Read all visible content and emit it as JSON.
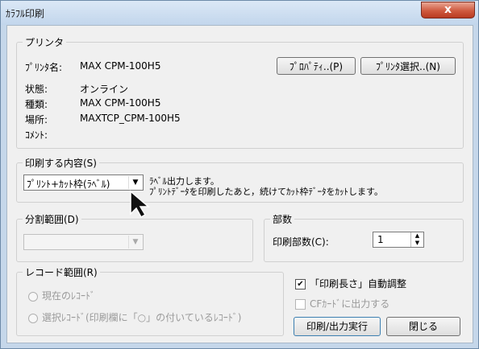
{
  "window": {
    "title": "ｶﾗﾌﾙ印刷",
    "close_label": "x"
  },
  "printer_group": {
    "legend": "プリンタ",
    "name_label": "ﾌﾟﾘﾝﾀ名:",
    "name_value": "MAX CPM-100H5",
    "status_label": "状態:",
    "status_value": "オンライン",
    "type_label": "種類:",
    "type_value": "MAX CPM-100H5",
    "location_label": "場所:",
    "location_value": "MAXTCP_CPM-100H5",
    "comment_label": "ｺﾒﾝﾄ:",
    "properties_button": "ﾌﾟﾛﾊﾟﾃｨ..(P)",
    "select_printer_button": "ﾌﾟﾘﾝﾀ選択..(N)"
  },
  "content_group": {
    "legend": "印刷する内容(S)",
    "select_value": "ﾌﾟﾘﾝﾄ+ｶｯﾄ枠(ﾗﾍﾞﾙ)",
    "description_line1": "ﾗﾍﾞﾙ出力します。",
    "description_line2": "ﾌﾟﾘﾝﾄﾃﾞｰﾀを印刷したあと，続けてｶｯﾄ枠ﾃﾞｰﾀをｶｯﾄします。"
  },
  "split_group": {
    "legend": "分割範囲(D)",
    "select_value": ""
  },
  "copies_group": {
    "legend": "部数",
    "label": "印刷部数(C):",
    "value": "1"
  },
  "record_group": {
    "legend": "レコード範囲(R)",
    "radio_current": "現在のﾚｺｰﾄﾞ",
    "radio_selected": "選択ﾚｺｰﾄﾞ(印刷欄に「○」の付いているﾚｺｰﾄﾞ)"
  },
  "options": {
    "auto_length_label": "「印刷長さ」自動調整",
    "auto_length_checked": true,
    "cf_card_label": "CFｶｰﾄﾞに出力する",
    "cf_card_checked": false
  },
  "actions": {
    "print_button": "印刷/出力実行",
    "close_button": "閉じる"
  }
}
